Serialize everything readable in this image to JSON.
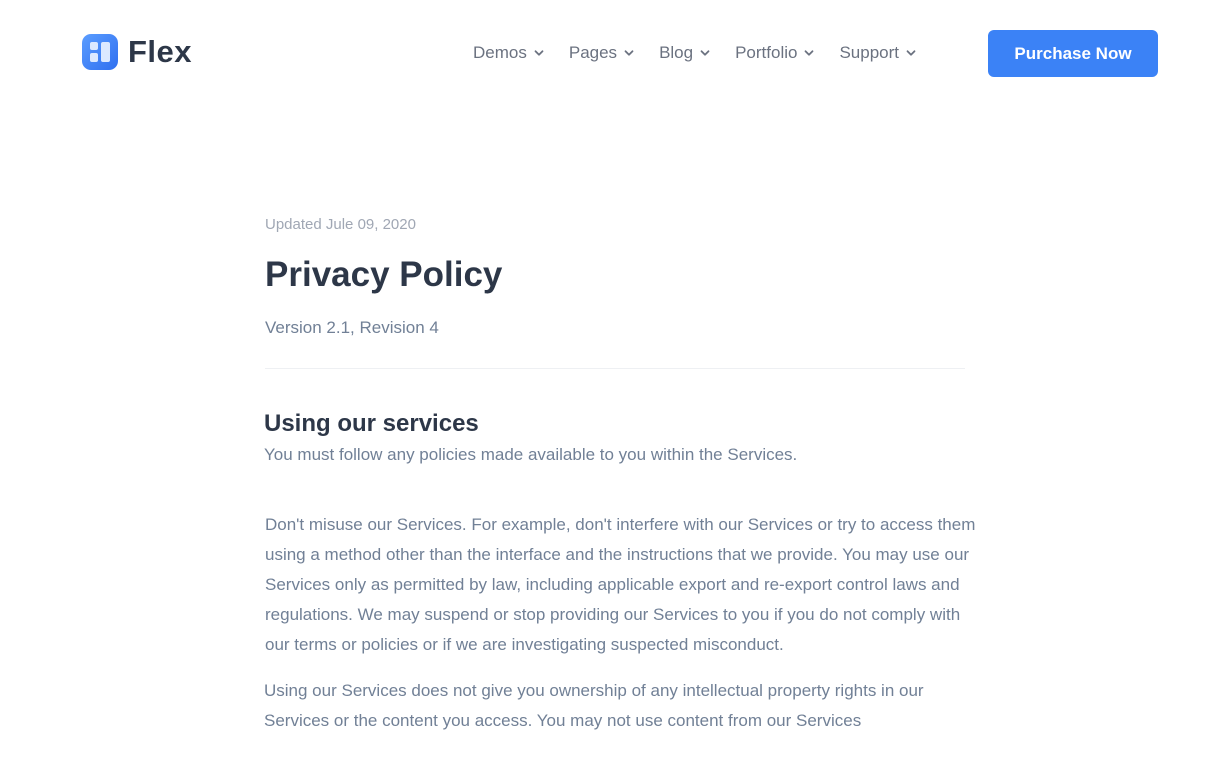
{
  "header": {
    "logo_text": "Flex",
    "nav": [
      {
        "label": "Demos"
      },
      {
        "label": "Pages"
      },
      {
        "label": "Blog"
      },
      {
        "label": "Portfolio"
      },
      {
        "label": "Support"
      }
    ],
    "cta_label": "Purchase Now"
  },
  "article": {
    "updated": "Updated Jule 09, 2020",
    "title": "Privacy Policy",
    "version": "Version 2.1, Revision 4",
    "section_title": "Using our services",
    "section_subtitle": "You must follow any policies made available to you within the Services.",
    "paragraphs": [
      "Don't misuse our Services. For example, don't interfere with our Services or try to access them using a method other than the interface and the instructions that we provide. You may use our Services only as permitted by law, including applicable export and re-export control laws and regulations. We may suspend or stop providing our Services to you if you do not comply with our terms or policies or if we are investigating suspected misconduct.",
      "Using our Services does not give you ownership of any intellectual property rights in our Services or the content you access. You may not use content from our Services"
    ]
  },
  "colors": {
    "accent": "#3b82f6",
    "heading": "#2d3748",
    "body_text": "#718096",
    "muted_text": "#a0a7b4"
  },
  "icons": {
    "logo": "flex-logo-icon",
    "nav_dropdown": "chevron-down-icon"
  }
}
